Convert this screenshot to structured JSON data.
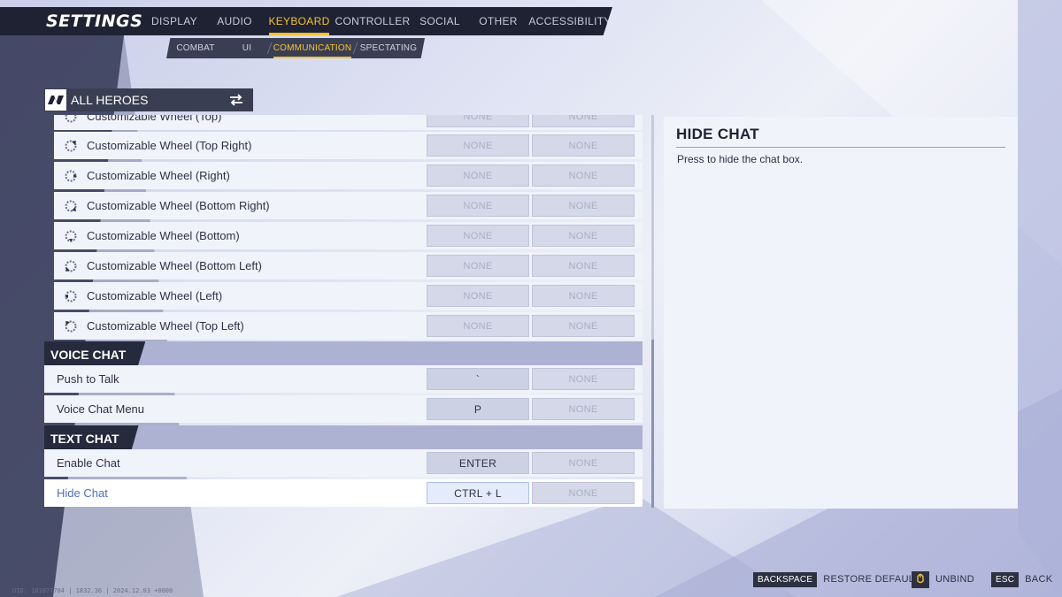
{
  "app": {
    "title": "SETTINGS"
  },
  "tabs": [
    {
      "label": "DISPLAY",
      "active": false
    },
    {
      "label": "AUDIO",
      "active": false
    },
    {
      "label": "KEYBOARD",
      "active": true
    },
    {
      "label": "CONTROLLER",
      "active": false
    },
    {
      "label": "SOCIAL",
      "active": false
    },
    {
      "label": "OTHER",
      "active": false
    },
    {
      "label": "ACCESSIBILITY",
      "active": false
    }
  ],
  "subtabs": [
    {
      "label": "COMBAT",
      "active": false
    },
    {
      "label": "UI",
      "active": false
    },
    {
      "label": "COMMUNICATION",
      "active": true
    },
    {
      "label": "SPECTATING",
      "active": false
    }
  ],
  "hero_select": {
    "label": "ALL HEROES",
    "logo_icon": "game-logo-icon",
    "swap_icon": "swap-arrows-icon"
  },
  "wheel_rows": [
    {
      "label": "Customizable Wheel (Top)",
      "key1": "NONE",
      "key2": "NONE",
      "icon": "wheel-top-icon"
    },
    {
      "label": "Customizable Wheel (Top Right)",
      "key1": "NONE",
      "key2": "NONE",
      "icon": "wheel-top-right-icon"
    },
    {
      "label": "Customizable Wheel (Right)",
      "key1": "NONE",
      "key2": "NONE",
      "icon": "wheel-right-icon"
    },
    {
      "label": "Customizable Wheel (Bottom Right)",
      "key1": "NONE",
      "key2": "NONE",
      "icon": "wheel-bottom-right-icon"
    },
    {
      "label": "Customizable Wheel (Bottom)",
      "key1": "NONE",
      "key2": "NONE",
      "icon": "wheel-bottom-icon"
    },
    {
      "label": "Customizable Wheel (Bottom Left)",
      "key1": "NONE",
      "key2": "NONE",
      "icon": "wheel-bottom-left-icon"
    },
    {
      "label": "Customizable Wheel (Left)",
      "key1": "NONE",
      "key2": "NONE",
      "icon": "wheel-left-icon"
    },
    {
      "label": "Customizable Wheel (Top Left)",
      "key1": "NONE",
      "key2": "NONE",
      "icon": "wheel-top-left-icon"
    }
  ],
  "voice_chat": {
    "header": "VOICE CHAT",
    "rows": [
      {
        "label": "Push to Talk",
        "key1": "`",
        "key2": "NONE"
      },
      {
        "label": "Voice Chat Menu",
        "key1": "P",
        "key2": "NONE"
      }
    ]
  },
  "text_chat": {
    "header": "TEXT CHAT",
    "rows": [
      {
        "label": "Enable Chat",
        "key1": "ENTER",
        "key2": "NONE"
      },
      {
        "label": "Hide Chat",
        "key1": "CTRL + L",
        "key2": "NONE",
        "selected": true
      }
    ]
  },
  "detail": {
    "title": "HIDE CHAT",
    "description": "Press to hide the chat box."
  },
  "footer": {
    "restore_key": "BACKSPACE",
    "restore_label": "RESTORE DEFAULTS",
    "unbind_label": "UNBIND",
    "unbind_icon": "mouse-icon",
    "back_key": "ESC",
    "back_label": "BACK",
    "uid_text": "UID: 181077784 | 1832.36 | 2024.12.03 +0000"
  },
  "colors": {
    "accent": "#f4c235",
    "nav_bg": "#1f2232",
    "section_bg": "#adb2d3",
    "selected_text": "#4e6ec0"
  }
}
